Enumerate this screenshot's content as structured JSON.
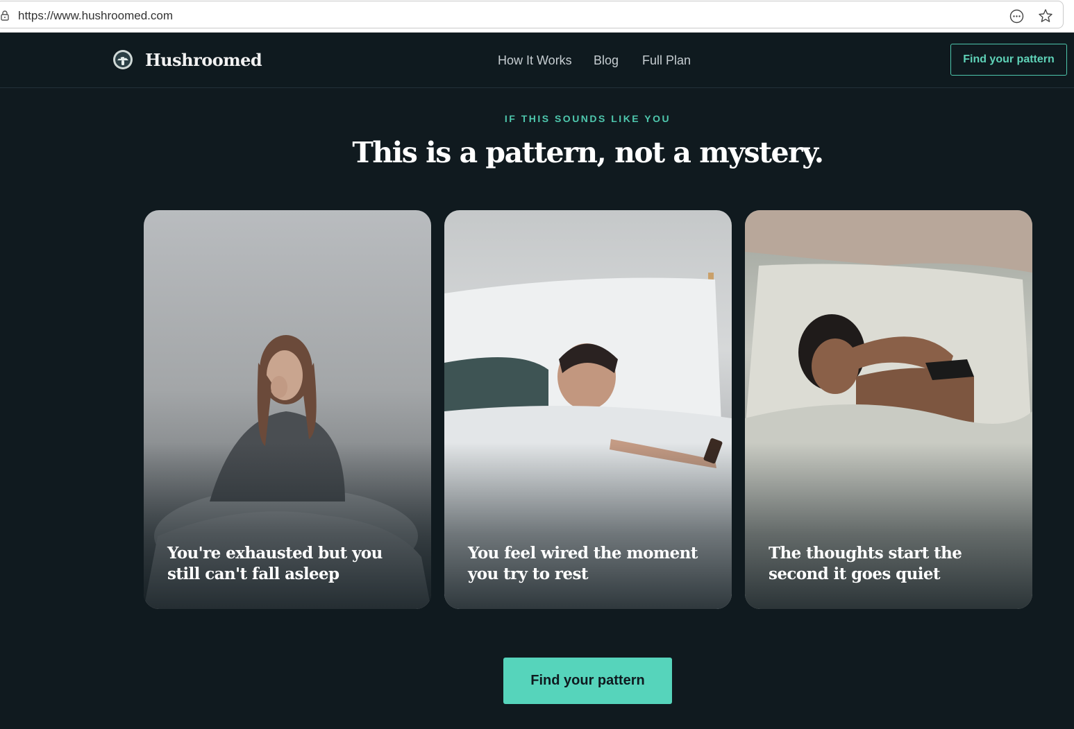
{
  "browser": {
    "url": "https://www.hushroomed.com",
    "icons": [
      "lock-icon",
      "more-icon",
      "bookmark-star-icon"
    ]
  },
  "header": {
    "brand": "Hushroomed",
    "nav": [
      "How It Works",
      "Blog",
      "Full Plan"
    ],
    "cta_label": "Find your pattern"
  },
  "hero": {
    "eyebrow": "IF THIS SOUNDS LIKE YOU",
    "headline": "This is a pattern, not a mystery."
  },
  "cards": [
    {
      "caption": "You're exhausted but you still can't fall asleep"
    },
    {
      "caption": "You feel wired the moment you try to rest"
    },
    {
      "caption": "The thoughts start the second it goes quiet"
    }
  ],
  "cta": {
    "label": "Find your pattern"
  },
  "colors": {
    "background": "#101a1f",
    "accent": "#56d4bb",
    "text": "#ffffff"
  }
}
